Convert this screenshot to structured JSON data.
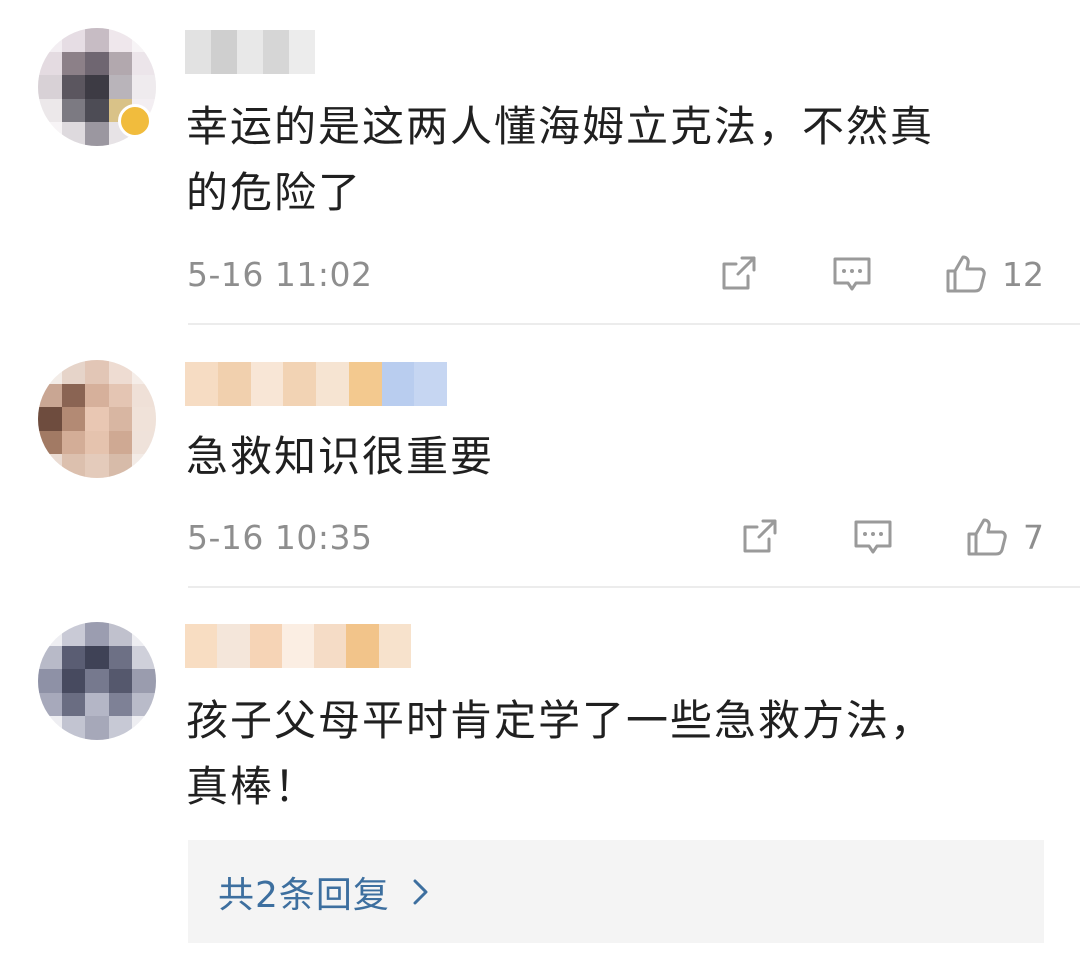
{
  "comments": [
    {
      "text": "幸运的是这两人懂海姆立克法，不然真\n的危险了",
      "time": "5-16 11:02",
      "likes": "12",
      "verified": true,
      "avatar_pixels": [
        "#f3eef2",
        "#e6dde4",
        "#c7bcc4",
        "#efe7ec",
        "#f7f4f6",
        "#e4dbe1",
        "#8c8088",
        "#6f6671",
        "#b2a8ae",
        "#ece5ea",
        "#d8d1d6",
        "#5b565f",
        "#3d3b44",
        "#b9b4ba",
        "#efebee",
        "#ece8ea",
        "#7c7a82",
        "#4d4c55",
        "#d9c288",
        "#f3eef2",
        "#f7f4f6",
        "#dedade",
        "#9b97a0",
        "#e7e3e6",
        "#f7f4f6"
      ],
      "name_blocks": [
        "#e2e2e2",
        "#cfcfcf",
        "#e8e8e8",
        "#d6d6d6",
        "#ececec"
      ]
    },
    {
      "text": "急救知识很重要",
      "time": "5-16 10:35",
      "likes": "7",
      "verified": false,
      "avatar_pixels": [
        "#f3ece7",
        "#e6d4c9",
        "#e2c6b6",
        "#eedcd2",
        "#f5ede8",
        "#c9a693",
        "#8a6453",
        "#d6b09b",
        "#e4c5b3",
        "#efe0d7",
        "#6e4c3e",
        "#b38a74",
        "#e9c7b3",
        "#d8b6a2",
        "#f0e2d9",
        "#a27a64",
        "#d3ad97",
        "#e5c3ae",
        "#cfa993",
        "#efe2da",
        "#eadbd2",
        "#dcc0ae",
        "#e4cbbb",
        "#d7bba9",
        "#f3ebe6"
      ],
      "name_blocks": [
        "#f6dcc3",
        "#f1d0ae",
        "#f8e6d6",
        "#f2d3b4",
        "#f6e4d2",
        "#f3c98f",
        "#b9cdef",
        "#c6d6f2"
      ]
    },
    {
      "text": "孩子父母平时肯定学了一些急救方法，\n真棒！",
      "time": "",
      "likes": "",
      "verified": false,
      "avatar_pixels": [
        "#eeeef2",
        "#c9cad6",
        "#9b9db0",
        "#c0c1cd",
        "#eeeef2",
        "#b8bac8",
        "#5a5d73",
        "#3f4256",
        "#6d7085",
        "#cfd0da",
        "#8e91a6",
        "#474a5f",
        "#76798e",
        "#55586d",
        "#9a9cae",
        "#a7a9bb",
        "#6a6d82",
        "#b4b6c6",
        "#7e8196",
        "#b9bbc9",
        "#eeeef2",
        "#c2c4d1",
        "#a6a8b9",
        "#c7c9d5",
        "#eeeef2"
      ],
      "name_blocks": [
        "#f8ddc2",
        "#f4e6da",
        "#f6d4b6",
        "#fbeee3",
        "#f5dcc6",
        "#f2c48a",
        "#f7e2cc"
      ]
    }
  ],
  "replies": {
    "label": "共2条回复",
    "chevron_icon": "chevron-right-icon"
  },
  "icons": {
    "share": "share-icon",
    "comment": "comment-icon",
    "like": "thumbs-up-icon"
  },
  "colors": {
    "text": "#202020",
    "meta": "#8e8e8e",
    "link": "#3d6f9f",
    "divider": "#ececec",
    "reply_bg": "#f4f4f4",
    "vip_badge": "#f1bc3d"
  }
}
